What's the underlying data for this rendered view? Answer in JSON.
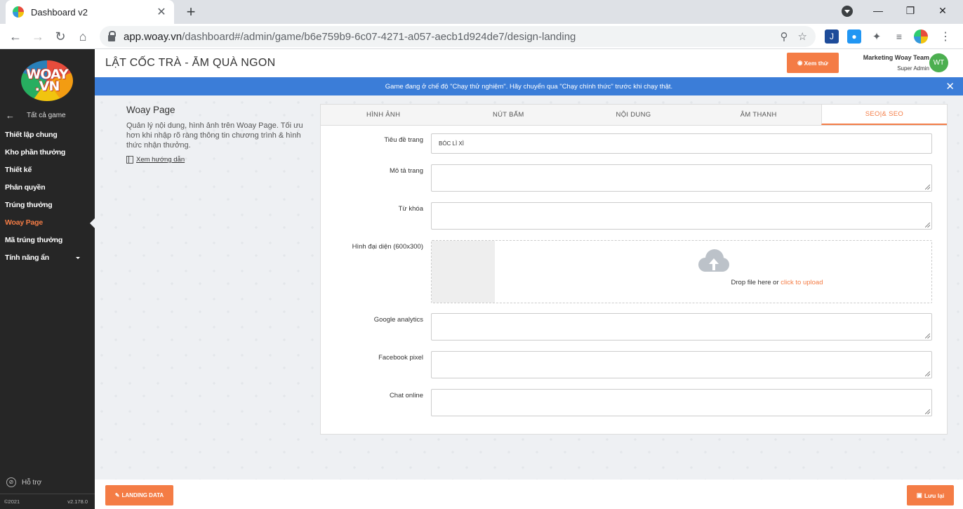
{
  "browser": {
    "tab_title": "Dashboard v2",
    "url_host": "app.woay.vn",
    "url_path": "/dashboard#/admin/game/b6e759b9-6c07-4271-a057-aecb1d924de7/design-landing"
  },
  "sidebar": {
    "logo_text": "WOAY .VN",
    "back_label": "Tất cả game",
    "items": [
      {
        "label": "Thiết lập chung"
      },
      {
        "label": "Kho phần thưởng"
      },
      {
        "label": "Thiết kế"
      },
      {
        "label": "Phân quyền"
      },
      {
        "label": "Trúng thưởng"
      },
      {
        "label": "Woay Page"
      },
      {
        "label": "Mã trúng thưởng"
      },
      {
        "label": "Tính năng ẩn"
      }
    ],
    "active_item": "Woay Page",
    "support_label": "Hỗ trợ",
    "copyright": "©2021",
    "version": "v2.178.0"
  },
  "header": {
    "title": "LẬT CỐC TRÀ - ẴM QUÀ NGON",
    "preview_label": "Xem thử",
    "user_name": "Marketing Woay Team",
    "user_role": "Super Admin",
    "avatar_initials": "WT"
  },
  "banner": {
    "message": "Game đang ở chế độ \"Chạy thử nghiệm\". Hãy chuyển qua \"Chạy chính thức\" trước khi chạy thật."
  },
  "info": {
    "title": "Woay Page",
    "description": "Quản lý nội dung, hình ảnh trên Woay Page. Tối ưu hơn khi nhập rõ ràng thông tin chương trình & hình thức nhận thưởng.",
    "guide_link": "Xem hướng dẫn"
  },
  "tabs": [
    {
      "label": "HÌNH ẢNH"
    },
    {
      "label": "NÚT BẤM"
    },
    {
      "label": "NỘI DUNG"
    },
    {
      "label": "ÂM THANH"
    },
    {
      "label": "SEO|& SEO"
    }
  ],
  "active_tab": "SEO|& SEO",
  "form": {
    "page_title_label": "Tiêu đề trang",
    "page_title_value": "BÓC LÌ XÌ",
    "page_desc_label": "Mô tả trang",
    "keywords_label": "Từ khóa",
    "avatar_label": "Hình đại diện (600x300)",
    "upload_text": "Drop file here or",
    "upload_link": "click to upload",
    "ga_label": "Google analytics",
    "fb_pixel_label": "Facebook pixel",
    "chat_label": "Chat online"
  },
  "footer": {
    "landing_data_label": "LANDING DATA",
    "save_label": "Lưu lại"
  },
  "colors": {
    "accent": "#f47c45",
    "banner": "#3b7dd8",
    "sidebar": "#262626",
    "avatar": "#4caf50"
  }
}
